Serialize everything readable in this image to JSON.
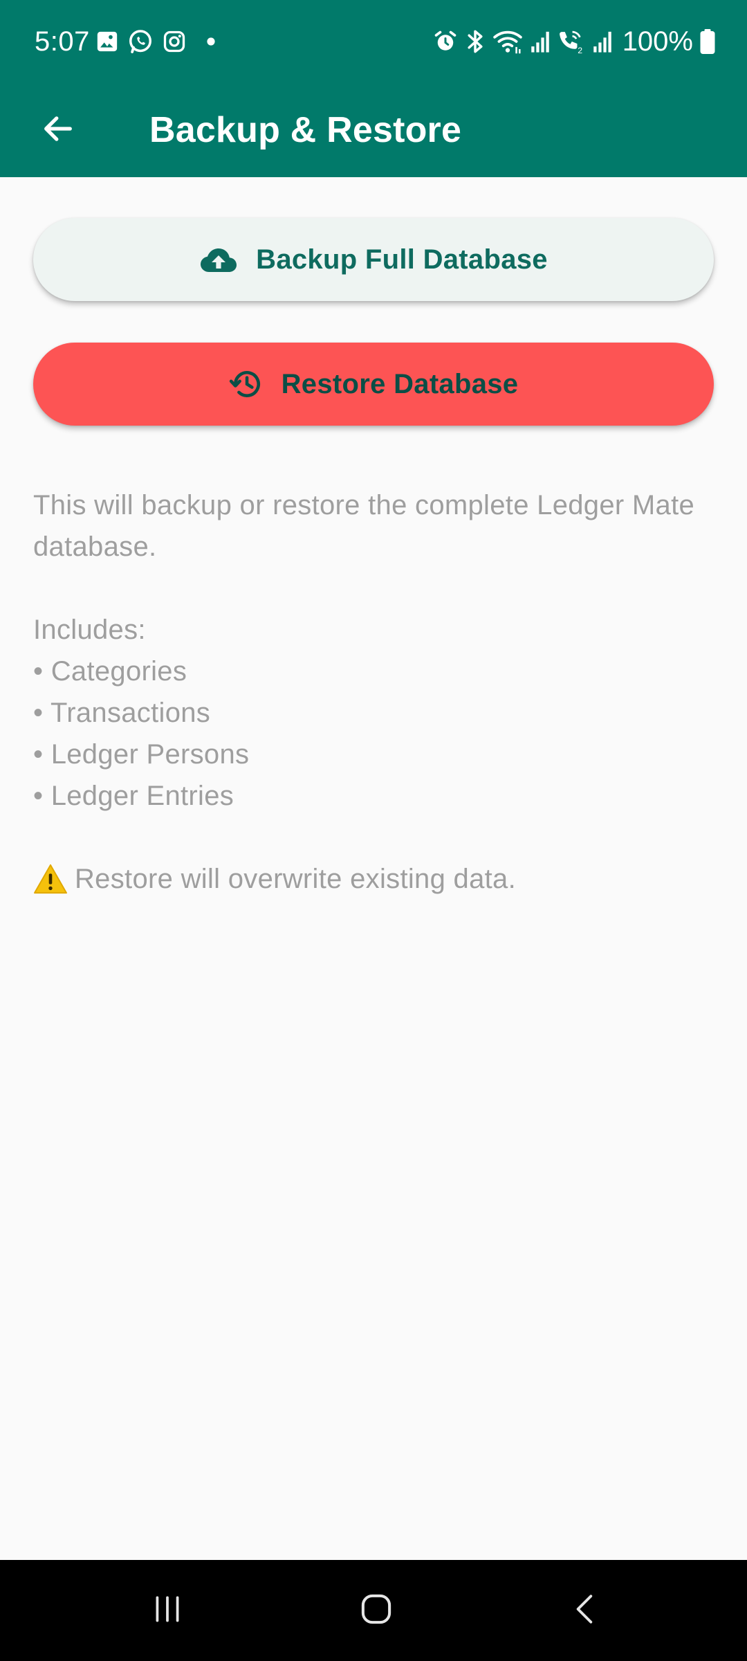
{
  "status_bar": {
    "time": "5:07",
    "battery": "100%",
    "left_icons": [
      "gallery-icon",
      "whatsapp-icon",
      "instagram-icon",
      "dot-icon"
    ],
    "right_icons": [
      "alarm-icon",
      "bluetooth-icon",
      "wifi-icon",
      "signal-icon",
      "wifi-calling-icon",
      "signal-icon",
      "battery-icon"
    ]
  },
  "app_bar": {
    "title": "Backup & Restore",
    "back_icon": "arrow-left-icon",
    "background": "#017a6a"
  },
  "actions": {
    "backup_label": "Backup Full Database",
    "backup_icon": "cloud-upload-icon",
    "restore_label": "Restore Database",
    "restore_icon": "history-icon",
    "restore_color": "#fd5454"
  },
  "info": {
    "intro": "This will backup or restore the complete Ledger Mate database.",
    "includes_heading": "Includes:",
    "items": [
      "• Categories",
      "• Transactions",
      "• Ledger Persons",
      "• Ledger Entries"
    ],
    "warning": "Restore will overwrite existing data.",
    "warning_icon": "warning-icon"
  },
  "nav_bar": {
    "buttons": [
      "recents-icon",
      "home-icon",
      "back-icon"
    ]
  }
}
